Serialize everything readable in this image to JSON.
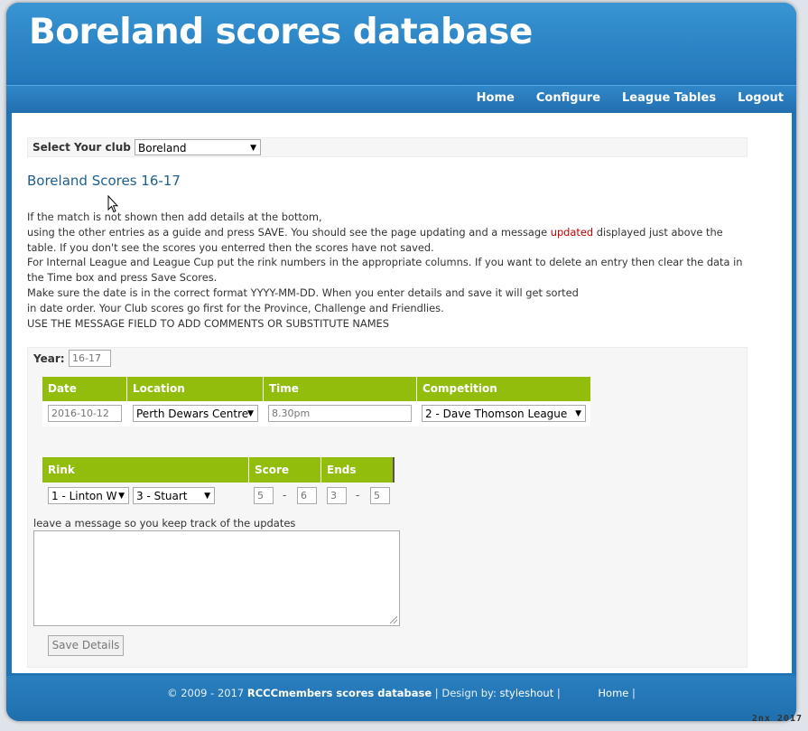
{
  "header": {
    "title": "Boreland scores database"
  },
  "nav": [
    "Home",
    "Configure",
    "League Tables",
    "Logout"
  ],
  "club": {
    "label": "Select Your club :",
    "selected": "Boreland"
  },
  "page_heading": "Boreland Scores 16-17",
  "instructions": {
    "l1": "If the match is not shown then add details at the bottom,",
    "l2a": "using the other entries as a guide and press SAVE. You should see the page updating and a message ",
    "l2red": "updated",
    "l2b": " displayed just above the table. If you don't see the scores you enterred then the scores have not saved.",
    "l3": "For Internal League and League Cup put the rink numbers in the appropriate columns. If you want to delete an entry then clear the data in the Time box and press Save Scores.",
    "l4": "Make sure the date is in the correct format YYYY-MM-DD. When you enter details and save it will get sorted",
    "l5": "in date order. Your Club scores go first for the Province, Challenge and Friendlies.",
    "l6": "USE THE MESSAGE FIELD TO ADD COMMENTS OR SUBSTITUTE NAMES"
  },
  "form": {
    "year_label": "Year:",
    "year_placeholder": "16-17",
    "table1": {
      "headers": [
        "Date",
        "Location",
        "Time",
        "Competition"
      ],
      "date_placeholder": "2016-10-12",
      "location_selected": "Perth Dewars Centre",
      "time_placeholder": "8.30pm",
      "competition_selected": "2 - Dave Thomson League"
    },
    "table2": {
      "headers": [
        "Rink",
        "Score",
        "Ends"
      ],
      "rink1_selected": "1 - Linton W",
      "rink2_selected": "3 - Stuart",
      "score_for": "5",
      "score_against": "6",
      "ends_for": "3",
      "ends_against": "5",
      "separator": "-"
    },
    "message_label": "leave a message so you keep track of the updates",
    "save_label": "Save Details"
  },
  "footer": {
    "copyright": "© 2009 - 2017 ",
    "site_name": "RCCCmembers scores database",
    "design_by": " | Design by: ",
    "designer": "styleshout",
    "sep1": " | ",
    "home": "Home",
    "sep2": " |"
  },
  "stamp": "2nx  2017"
}
